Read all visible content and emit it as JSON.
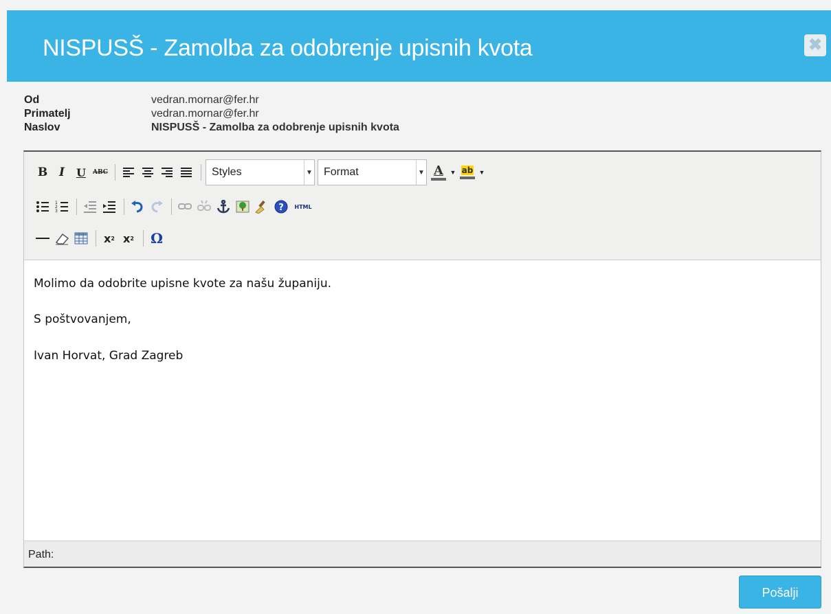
{
  "dialog": {
    "title": "NISPUSŠ - Zamolba za odobrenje upisnih kvota",
    "close_icon": "close-icon"
  },
  "meta": {
    "from_label": "Od",
    "from_value": "vedran.mornar@fer.hr",
    "to_label": "Primatelj",
    "to_value": "vedran.mornar@fer.hr",
    "subject_label": "Naslov",
    "subject_value": "NISPUSŠ - Zamolba za odobrenje upisnih kvota"
  },
  "toolbar": {
    "bold": "B",
    "italic": "I",
    "underline": "U",
    "strike": "ABC",
    "styles_label": "Styles",
    "format_label": "Format",
    "forecolor": "A",
    "backcolor": "ab",
    "html_label": "HTML",
    "subscript": "x",
    "superscript": "x",
    "charmap": "Ω"
  },
  "content": {
    "line1": "Molimo da odobrite upisne kvote za našu županiju.",
    "line2": "S poštvovanjem,",
    "line3": "Ivan Horvat, Grad Zagreb"
  },
  "path_label": "Path:",
  "send_label": "Pošalji",
  "colors": {
    "accent": "#3ab4e4",
    "toolbar_bg": "#f0f0ee"
  }
}
